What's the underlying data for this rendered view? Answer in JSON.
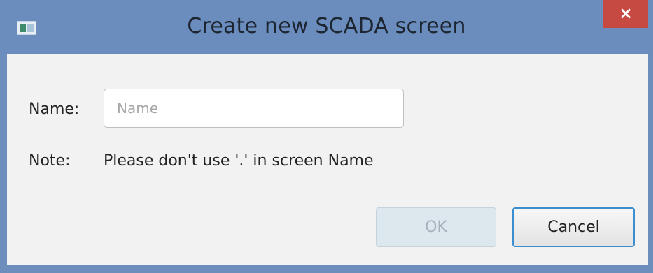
{
  "window": {
    "title": "Create new SCADA screen",
    "close_label": "×"
  },
  "form": {
    "name_label": "Name:",
    "name_value": "",
    "name_placeholder": "Name",
    "note_label": "Note:",
    "note_text": "Please don't use '.' in screen Name"
  },
  "buttons": {
    "ok_label": "OK",
    "ok_enabled": false,
    "cancel_label": "Cancel"
  },
  "icons": {
    "app": "app-window-icon",
    "close": "close-icon"
  },
  "colors": {
    "titlebar": "#6a8dbd",
    "close_button": "#c74a42",
    "focus_border": "#3b8fd0",
    "content_background": "#f2f2f2"
  }
}
